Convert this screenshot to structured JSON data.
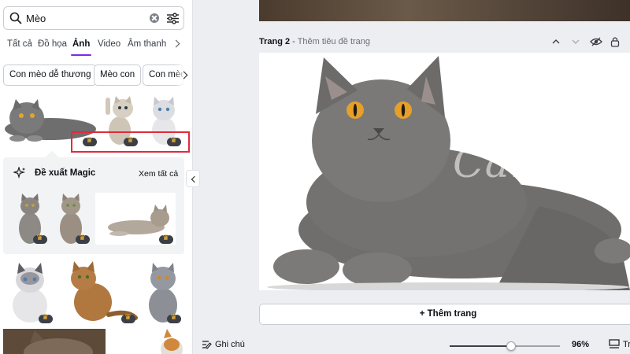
{
  "search": {
    "value": "Mèo",
    "placeholder": ""
  },
  "tabs": [
    {
      "label": "Tất cả",
      "active": false
    },
    {
      "label": "Đồ họa",
      "active": false
    },
    {
      "label": "Ảnh",
      "active": true
    },
    {
      "label": "Video",
      "active": false
    },
    {
      "label": "Âm thanh",
      "active": false
    }
  ],
  "chips": [
    "Con mèo dễ thương",
    "Mèo con",
    "Con mèo"
  ],
  "magic": {
    "title": "Đề xuất Magic",
    "see_all": "Xem tất cả"
  },
  "page": {
    "number_label": "Trang 2",
    "separator": " - ",
    "title_placeholder": "Thêm tiêu đề trang"
  },
  "watermark": "Canva",
  "add_page_label": "+ Thêm trang",
  "bottom": {
    "notes_label": "Ghi chú",
    "zoom_percent": "96%",
    "zoom_level": 0.56,
    "pages_label": "Tr"
  },
  "colors": {
    "accent": "#7d2ae8",
    "highlight": "#e02b3c",
    "crown": "#f7b733"
  }
}
